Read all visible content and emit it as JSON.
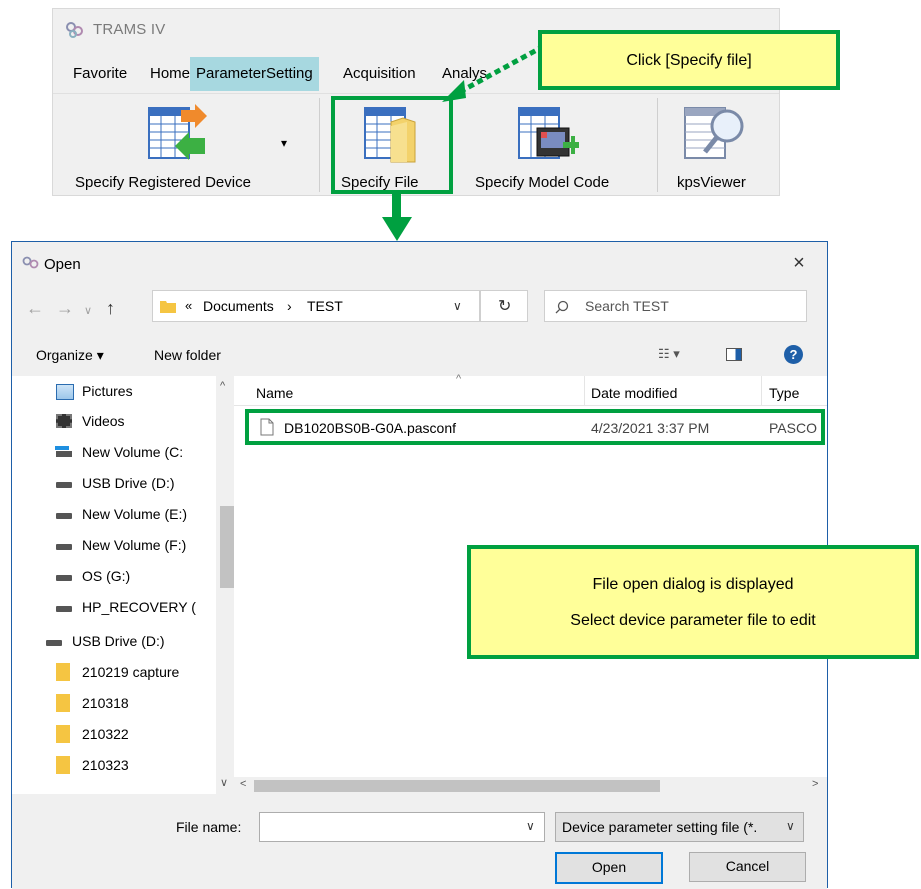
{
  "trams": {
    "title": "TRAMS IV",
    "menu": [
      "Favorite",
      "Home",
      "ParameterSetting",
      "Acquisition",
      "Analys"
    ],
    "ribbon": {
      "specify_registered_device": "Specify Registered Device",
      "specify_file": "Specify File",
      "specify_model_code": "Specify Model Code",
      "kps_viewer": "kpsViewer"
    }
  },
  "callouts": {
    "click_specify": "Click [Specify file]",
    "dialog_line1": "File open dialog is displayed",
    "dialog_line2": "Select device parameter file to edit"
  },
  "dialog": {
    "title": "Open",
    "close": "×",
    "breadcrumb": {
      "prefix": "«",
      "folder1": "Documents",
      "sep": "›",
      "folder2": "TEST"
    },
    "search_placeholder": "Search TEST",
    "organize": "Organize ▾",
    "new_folder": "New folder",
    "columns": {
      "name": "Name",
      "date": "Date modified",
      "type": "Type"
    },
    "file": {
      "name": "DB1020BS0B-G0A.pasconf",
      "date": "4/23/2021 3:37 PM",
      "type": "PASCO"
    },
    "nav_items": [
      {
        "label": "Pictures",
        "icon": "pictures-icon"
      },
      {
        "label": "Videos",
        "icon": "videos-icon"
      },
      {
        "label": "New Volume (C:",
        "icon": "windows-drive-icon"
      },
      {
        "label": "USB Drive (D:)",
        "icon": "drive-icon"
      },
      {
        "label": "New Volume (E:)",
        "icon": "drive-icon"
      },
      {
        "label": "New Volume (F:)",
        "icon": "drive-icon"
      },
      {
        "label": "OS (G:)",
        "icon": "drive-icon"
      },
      {
        "label": "HP_RECOVERY (",
        "icon": "drive-icon"
      },
      {
        "label": "USB Drive (D:)",
        "icon": "drive-icon"
      },
      {
        "label": "210219 capture",
        "icon": "folder-icon"
      },
      {
        "label": "210318",
        "icon": "folder-icon"
      },
      {
        "label": "210322",
        "icon": "folder-icon"
      },
      {
        "label": "210323",
        "icon": "folder-icon"
      }
    ],
    "file_name_label": "File name:",
    "file_name_value": "",
    "filter": "Device parameter setting file (*.",
    "open": "Open",
    "cancel": "Cancel"
  },
  "colors": {
    "accent_green": "#00a040",
    "callout_yellow": "#ffff99",
    "menu_active": "#a7d8e0"
  }
}
